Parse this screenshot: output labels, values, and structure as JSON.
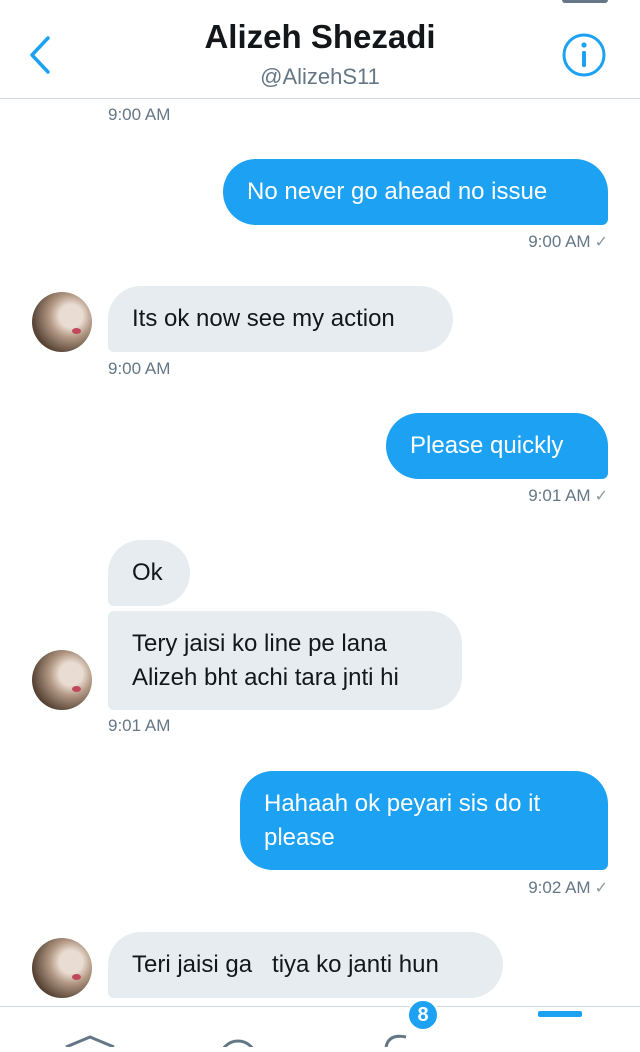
{
  "header": {
    "name": "Alizeh Shezadi",
    "handle": "@AlizehS11"
  },
  "messages": [
    {
      "kind": "timestamp",
      "time": "9:00 AM"
    },
    {
      "kind": "outgoing",
      "text": "No never go ahead no issue",
      "time": "9:00 AM",
      "check": "✓"
    },
    {
      "kind": "incoming",
      "text": "Its ok now see my action",
      "time": "9:00 AM"
    },
    {
      "kind": "outgoing",
      "text": "Please quickly",
      "time": "9:01 AM",
      "check": "✓"
    },
    {
      "kind": "incoming",
      "text": "Ok"
    },
    {
      "kind": "incoming",
      "text_line1": "Tery jaisi ko line pe lana",
      "text_line2": "Alizeh bht achi tara jnti hi",
      "time": "9:01 AM"
    },
    {
      "kind": "outgoing",
      "text_line1": "Hahaah ok peyari sis do it",
      "text_line2": "please",
      "time": "9:02 AM",
      "check": "✓"
    },
    {
      "kind": "incoming",
      "text": "Teri jaisi ga   tiya ko janti hun"
    }
  ],
  "tabbar": {
    "notifications_badge": "8"
  },
  "colors": {
    "accent": "#1da1f2",
    "incoming_bubble": "#e6ecf0",
    "secondary_text": "#657786"
  },
  "icons": [
    "back-chevron-icon",
    "info-icon",
    "home-icon",
    "search-icon",
    "notifications-icon",
    "messages-icon"
  ]
}
